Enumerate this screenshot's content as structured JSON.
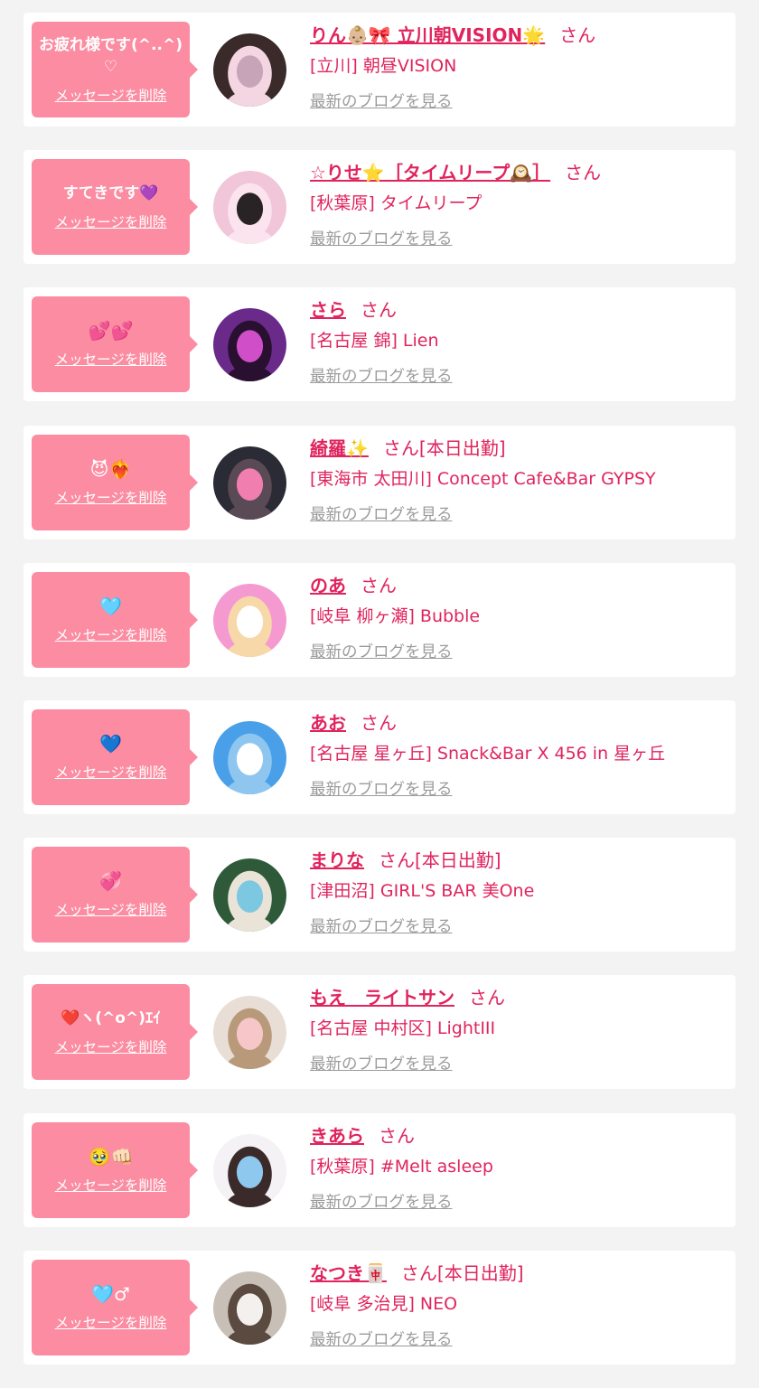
{
  "delete_label": "メッセージを削除",
  "blog_label": "最新のブログを見る",
  "san_label": "さん",
  "colors": {
    "background": "#f3f3f3",
    "card": "#ffffff",
    "bubble": "#fb8ca1",
    "name": "#e0245e",
    "blog_link": "#9b9b9b"
  },
  "items": [
    {
      "message": "お疲れ様です(^..^)♡",
      "name": "りん👶🏼🎀 立川朝VISION🌟",
      "status": "",
      "shop": "[立川] 朝昼VISION",
      "avatar_icon": "bunny-filter-photo",
      "avatar_colors": [
        "#3b2a2a",
        "#c8a4b8",
        "#f3d6e2"
      ]
    },
    {
      "message": "すてきです💜",
      "name": "☆りせ⭐️［タイムリープ🕰️］",
      "status": "",
      "shop": "[秋葉原] タイムリープ",
      "avatar_icon": "girl-pink-room-photo",
      "avatar_colors": [
        "#f0c6d8",
        "#2a2326",
        "#fbe4ee"
      ]
    },
    {
      "message": "💕💕",
      "name": "さら",
      "status": "",
      "shop": "[名古屋 錦] Lien",
      "avatar_icon": "purple-light-photo",
      "avatar_colors": [
        "#6a2a8a",
        "#d04fc8",
        "#2a1030"
      ]
    },
    {
      "message": "😈❤️‍🔥",
      "name": "綺羅✨",
      "status": "[本日出勤]",
      "shop": "[東海市 太田川] Concept Cafe&Bar GYPSY",
      "avatar_icon": "flower-face-photo",
      "avatar_colors": [
        "#2b2b35",
        "#f07fb0",
        "#5a4a55"
      ]
    },
    {
      "message": "🩵",
      "name": "のあ",
      "status": "",
      "shop": "[岐阜 柳ヶ瀬] Bubble",
      "avatar_icon": "bubble-magazine-photo",
      "avatar_colors": [
        "#f59ad0",
        "#ffffff",
        "#f7d8a8"
      ]
    },
    {
      "message": "💙",
      "name": "あお",
      "status": "",
      "shop": "[名古屋 星ヶ丘] Snack&Bar X 456 in 星ヶ丘",
      "avatar_icon": "sky-clouds-photo",
      "avatar_colors": [
        "#4aa0e8",
        "#ffffff",
        "#8fc6f0"
      ]
    },
    {
      "message": "💞",
      "name": "まりな",
      "status": "[本日出勤]",
      "shop": "[津田沼] GIRL'S BAR 美One",
      "avatar_icon": "pool-resort-photo",
      "avatar_colors": [
        "#2f5a3a",
        "#7cc8e0",
        "#eae4d8"
      ]
    },
    {
      "message": "❤️ヽ(^o^)ｴｲ",
      "name": "もえ　ライトサン",
      "status": "",
      "shop": "[名古屋 中村区] LightIII",
      "avatar_icon": "blurred-face-photo",
      "avatar_colors": [
        "#e8ded6",
        "#f6c6c8",
        "#b89a7a"
      ]
    },
    {
      "message": "🥹👊🏻",
      "name": "きあら",
      "status": "",
      "shop": "[秋葉原] #Melt asleep",
      "avatar_icon": "blue-dress-photo",
      "avatar_colors": [
        "#f4f2f4",
        "#8fc8ee",
        "#3a2a2a"
      ]
    },
    {
      "message": "🩵♂︎",
      "name": "なつき🀄",
      "status": "[本日出勤]",
      "shop": "[岐阜 多治見] NEO",
      "avatar_icon": "white-dress-photo",
      "avatar_colors": [
        "#c8c0b6",
        "#f4f0ee",
        "#5a4a40"
      ]
    }
  ]
}
